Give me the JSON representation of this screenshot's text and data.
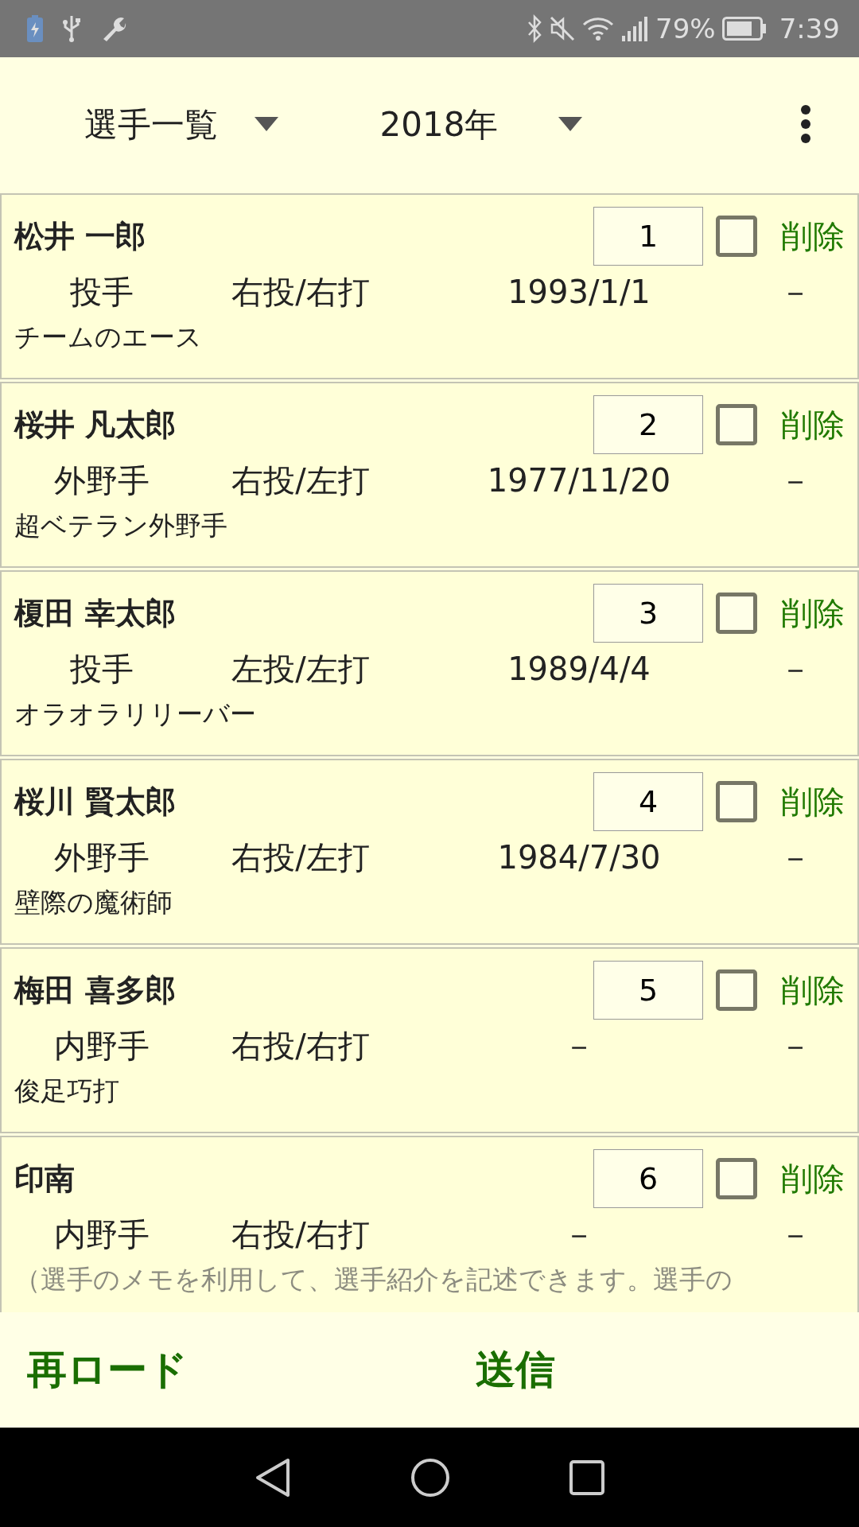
{
  "status_bar": {
    "battery": "79%",
    "time": "7:39"
  },
  "header": {
    "view_dropdown": "選手一覧",
    "year_dropdown": "2018年"
  },
  "players": [
    {
      "name": "松井 一郎",
      "number": "1",
      "checked": false,
      "delete": "削除",
      "position": "投手",
      "hand": "右投/右打",
      "birthday": "1993/1/1",
      "column_4": "－",
      "memo": "チームのエース"
    },
    {
      "name": "桜井 凡太郎",
      "number": "2",
      "checked": false,
      "delete": "削除",
      "position": "外野手",
      "hand": "右投/左打",
      "birthday": "1977/11/20",
      "column_4": "－",
      "memo": "超ベテラン外野手"
    },
    {
      "name": "榎田 幸太郎",
      "number": "3",
      "checked": false,
      "delete": "削除",
      "position": "投手",
      "hand": "左投/左打",
      "birthday": "1989/4/4",
      "column_4": "－",
      "memo": "オラオラリリーバー"
    },
    {
      "name": "桜川 賢太郎",
      "number": "4",
      "checked": false,
      "delete": "削除",
      "position": "外野手",
      "hand": "右投/左打",
      "birthday": "1984/7/30",
      "column_4": "－",
      "memo": "壁際の魔術師"
    },
    {
      "name": "梅田 喜多郎",
      "number": "5",
      "checked": false,
      "delete": "削除",
      "position": "内野手",
      "hand": "右投/右打",
      "birthday": "－",
      "column_4": "－",
      "memo": "俊足巧打"
    },
    {
      "name": "印南",
      "number": "6",
      "checked": false,
      "delete": "削除",
      "position": "内野手",
      "hand": "右投/右打",
      "birthday": "－",
      "column_4": "－",
      "memo_placeholder": "（選手のメモを利用して、選手紹介を記述できます。選手の"
    }
  ],
  "footer": {
    "reload": "再ロード",
    "send": "送信"
  }
}
